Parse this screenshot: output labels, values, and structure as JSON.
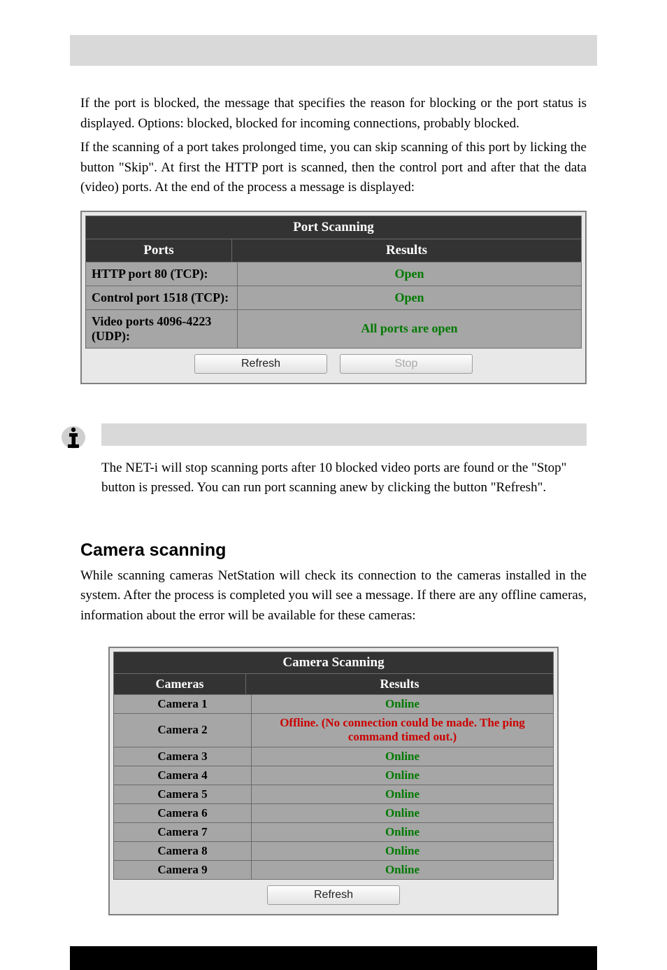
{
  "intro_para1": "If the port is blocked, the message that specifies the reason for blocking or the port status is displayed. Options: blocked, blocked for incoming connections, probably blocked.",
  "intro_para2": "If the scanning of a port takes prolonged time, you can skip scanning of this port by licking the button \"Skip\". At first the HTTP port is scanned, then the control port and after that the data (video) ports. At the end of the process a message is displayed:",
  "port_scanning": {
    "title": "Port Scanning",
    "headers": {
      "ports": "Ports",
      "results": "Results"
    },
    "rows": [
      {
        "port": "HTTP port 80 (TCP):",
        "result": "Open"
      },
      {
        "port": "Control port 1518 (TCP):",
        "result": "Open"
      },
      {
        "port": "Video ports 4096-4223 (UDP):",
        "result": "All ports are open"
      }
    ],
    "buttons": {
      "refresh": "Refresh",
      "stop": "Stop"
    }
  },
  "note_text": "The NET-i will stop scanning ports after 10 blocked video ports are found or the \"Stop\" button is pressed. You can run port scanning anew by clicking the button \"Refresh\".",
  "camera_heading": "Camera scanning",
  "camera_para": "While scanning cameras NetStation will check its connection to the cameras installed in the system. After the process is completed you will see a message. If there are any offline cameras, information about the error will be available for these cameras:",
  "camera_scanning": {
    "title": "Camera Scanning",
    "headers": {
      "cameras": "Cameras",
      "results": "Results"
    },
    "rows": [
      {
        "cam": "Camera 1",
        "status": "Online",
        "online": true
      },
      {
        "cam": "Camera 2",
        "status": "Offline. (No connection could be made. The ping command timed out.)",
        "online": false
      },
      {
        "cam": "Camera 3",
        "status": "Online",
        "online": true
      },
      {
        "cam": "Camera 4",
        "status": "Online",
        "online": true
      },
      {
        "cam": "Camera 5",
        "status": "Online",
        "online": true
      },
      {
        "cam": "Camera 6",
        "status": "Online",
        "online": true
      },
      {
        "cam": "Camera 7",
        "status": "Online",
        "online": true
      },
      {
        "cam": "Camera 8",
        "status": "Online",
        "online": true
      },
      {
        "cam": "Camera 9",
        "status": "Online",
        "online": true
      }
    ],
    "buttons": {
      "refresh": "Refresh"
    }
  }
}
